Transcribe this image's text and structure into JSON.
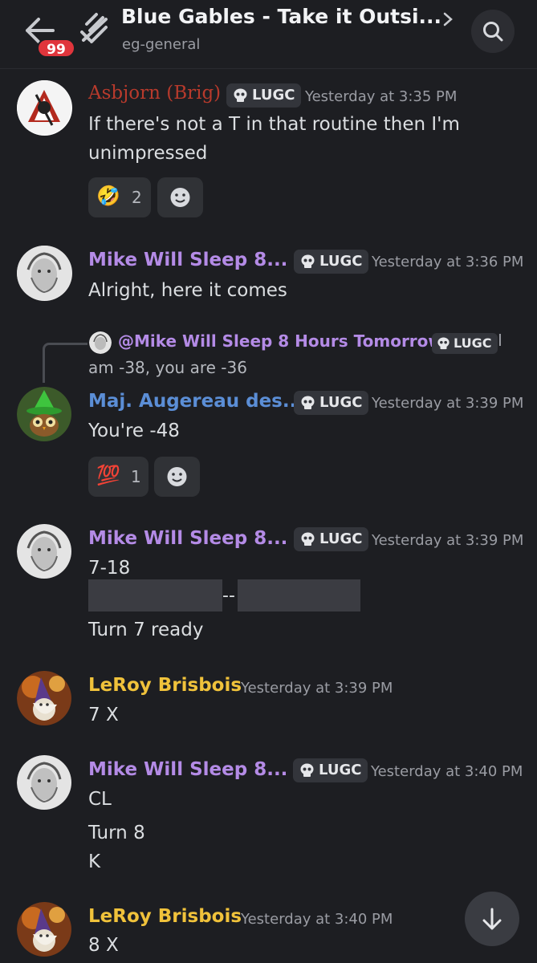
{
  "header": {
    "channel_title": "Blue Gables - Take it Outsi...",
    "subtitle": "eg-general",
    "unread_count": "99"
  },
  "colors": {
    "background": "#1d1e22",
    "purple_name": "#b48be6",
    "blue_name": "#5b8ed6",
    "gold_name": "#f0c23b",
    "red_name": "#b73a2c"
  },
  "messages": [
    {
      "author": "Asbjorn (Brig)",
      "tag": "LUGC",
      "time": "Yesterday at 3:35 PM",
      "lines": [
        "If there's not a T in that routine then I'm",
        "unimpressed"
      ],
      "reactions": [
        {
          "emoji": "🤣",
          "count": "2"
        }
      ]
    },
    {
      "author": "Mike Will Sleep 8...",
      "tag": "LUGC",
      "time": "Yesterday at 3:36 PM",
      "lines": [
        "Alright, here it comes"
      ]
    },
    {
      "reply": {
        "author": "@Mike Will Sleep 8 Hours Tomorrow",
        "tag": "LUGC",
        "pipe": "I",
        "text": "am -38, you are -36"
      },
      "author": "Maj. Augereau des...",
      "tag": "LUGC",
      "time": "Yesterday at 3:39 PM",
      "lines": [
        "You're -48"
      ],
      "reactions": [
        {
          "emoji": "💯",
          "count": "1"
        }
      ]
    },
    {
      "author": "Mike Will Sleep 8...",
      "tag": "LUGC",
      "time": "Yesterday at 3:39 PM",
      "lines": [
        "7-18",
        "Turn 7 ready"
      ],
      "spoiler_sep": "--"
    },
    {
      "author": "LeRoy Brisbois",
      "time": "Yesterday at 3:39 PM",
      "lines": [
        "7 X"
      ]
    },
    {
      "author": "Mike Will Sleep 8...",
      "tag": "LUGC",
      "time": "Yesterday at 3:40 PM",
      "lines": [
        "CL",
        "Turn 8",
        "K"
      ]
    },
    {
      "author": "LeRoy Brisbois",
      "time": "Yesterday at 3:40 PM",
      "lines": [
        "8 X"
      ]
    }
  ],
  "icons": {
    "back": "arrow-left-icon",
    "thread": "thread-icon",
    "chevron": "chevron-right-icon",
    "search": "search-icon",
    "skull": "skull-icon",
    "add_reaction": "smiley-icon",
    "jump": "arrow-down-icon"
  }
}
